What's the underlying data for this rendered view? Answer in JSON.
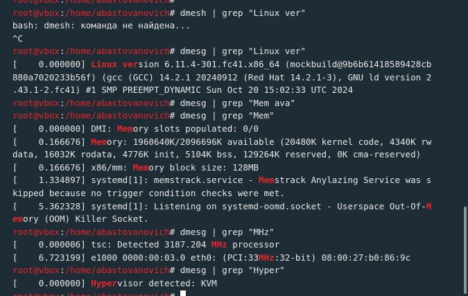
{
  "prompt": {
    "user_host": "root@vbox",
    "colon": ":",
    "path": "/home/abastovanovich",
    "symbol": "# "
  },
  "colors": {
    "background": "#1e2c35",
    "text": "#e6e6e6",
    "highlight": "#e5262a",
    "prompt": "#e5262a"
  },
  "lines": [
    {
      "type": "prompt",
      "cmd": ""
    },
    {
      "type": "prompt",
      "cmd": "dmesh | grep \"Linux ver\""
    },
    {
      "type": "text",
      "segments": [
        {
          "t": "bash: dmesh: команда не найдена..."
        }
      ]
    },
    {
      "type": "text",
      "segments": [
        {
          "t": "^C"
        }
      ]
    },
    {
      "type": "prompt",
      "cmd": "dmesg | grep \"Linux ver\""
    },
    {
      "type": "text",
      "segments": [
        {
          "t": "[    0.000000] "
        },
        {
          "t": "Linux ver",
          "hl": true
        },
        {
          "t": "sion 6.11.4-301.fc41.x86_64 (mockbuild@9b6b61418589428cb"
        }
      ]
    },
    {
      "type": "text",
      "segments": [
        {
          "t": "880a7020233b56f) (gcc (GCC) 14.2.1 20240912 (Red Hat 14.2.1-3), GNU ld version 2"
        }
      ]
    },
    {
      "type": "text",
      "segments": [
        {
          "t": ".43.1-2.fc41) #1 SMP PREEMPT_DYNAMIC Sun Oct 20 15:02:33 UTC 2024"
        }
      ]
    },
    {
      "type": "prompt",
      "cmd": "dmesg | grep \"Mem ava\""
    },
    {
      "type": "prompt",
      "cmd": "dmesg | grep \"Mem\""
    },
    {
      "type": "text",
      "segments": [
        {
          "t": "[    0.000000] DMI: "
        },
        {
          "t": "Mem",
          "hl": true
        },
        {
          "t": "ory slots populated: 0/0"
        }
      ]
    },
    {
      "type": "text",
      "segments": [
        {
          "t": "[    0.166676] "
        },
        {
          "t": "Mem",
          "hl": true
        },
        {
          "t": "ory: 1960640K/2096696K available (20480K kernel code, 4340K rw"
        }
      ]
    },
    {
      "type": "text",
      "segments": [
        {
          "t": "data, 16032K rodata, 4776K init, 5104K bss, 129264K reserved, 0K cma-reserved)"
        }
      ]
    },
    {
      "type": "text",
      "segments": [
        {
          "t": "[    0.166676] x86/mm: "
        },
        {
          "t": "Mem",
          "hl": true
        },
        {
          "t": "ory block size: 128MB"
        }
      ]
    },
    {
      "type": "text",
      "segments": [
        {
          "t": "[    1.334897] systemd[1]: memstrack.service - "
        },
        {
          "t": "Mem",
          "hl": true
        },
        {
          "t": "strack Anylazing Service was s"
        }
      ]
    },
    {
      "type": "text",
      "segments": [
        {
          "t": "kipped because no trigger condition checks were met."
        }
      ]
    },
    {
      "type": "text",
      "segments": [
        {
          "t": "[    5.362328] systemd[1]: Listening on systemd-oomd.socket - Userspace Out-Of-"
        },
        {
          "t": "M",
          "hl": true
        }
      ]
    },
    {
      "type": "text",
      "segments": [
        {
          "t": "em",
          "hl": true
        },
        {
          "t": "ory (OOM) Killer Socket."
        }
      ]
    },
    {
      "type": "prompt",
      "cmd": "dmesg | grep \"MHz\""
    },
    {
      "type": "text",
      "segments": [
        {
          "t": "[    0.000006] tsc: Detected 3187.204 "
        },
        {
          "t": "MHz",
          "hl": true
        },
        {
          "t": " processor"
        }
      ]
    },
    {
      "type": "text",
      "segments": [
        {
          "t": "[    6.723199] e1000 0000:00:03.0 eth0: (PCI:33"
        },
        {
          "t": "MHz",
          "hl": true
        },
        {
          "t": ":32-bit) 08:00:27:b0:86:9c"
        }
      ]
    },
    {
      "type": "prompt",
      "cmd": "dmesg | grep \"Hyper\""
    },
    {
      "type": "text",
      "segments": [
        {
          "t": "[    0.000000] "
        },
        {
          "t": "Hyper",
          "hl": true
        },
        {
          "t": "visor detected: KVM"
        }
      ]
    },
    {
      "type": "prompt",
      "cmd": "",
      "cursor": true
    }
  ]
}
